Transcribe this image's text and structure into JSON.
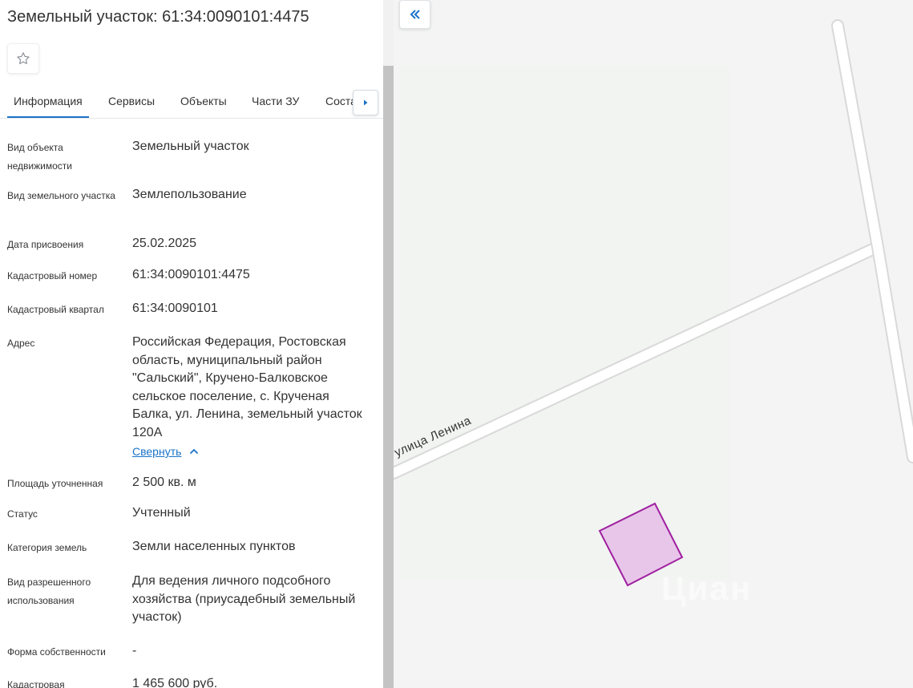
{
  "title": "Земельный участок: 61:34:0090101:4475",
  "favorite_icon": "star-outline-icon",
  "tabs": [
    {
      "label": "Информация",
      "active": true
    },
    {
      "label": "Сервисы",
      "active": false
    },
    {
      "label": "Объекты",
      "active": false
    },
    {
      "label": "Части ЗУ",
      "active": false
    },
    {
      "label": "Соста",
      "active": false
    }
  ],
  "tab_next_icon": "triangle-right-icon",
  "fields": [
    {
      "label": "Вид объекта недвижимости",
      "value": "Земельный участок"
    },
    {
      "label": "Вид земельного участка",
      "value": "Землепользование"
    },
    {
      "label": "Дата присвоения",
      "value": "25.02.2025"
    },
    {
      "label": "Кадастровый номер",
      "value": "61:34:0090101:4475"
    },
    {
      "label": "Кадастровый квартал",
      "value": "61:34:0090101"
    },
    {
      "label": "Адрес",
      "value": "Российская Федерация, Ростовская область, муниципальный район \"Сальский\", Кручено-Балковское сельское поселение, с. Крученая Балка, ул. Ленина, земельный участок 120А"
    },
    {
      "label": "Площадь уточненная",
      "value": "2 500 кв. м"
    },
    {
      "label": "Статус",
      "value": "Учтенный"
    },
    {
      "label": "Категория земель",
      "value": "Земли населенных пунктов"
    },
    {
      "label": "Вид разрешенного использования",
      "value": "Для ведения личного подсобного хозяйства (приусадебный земельный участок)"
    },
    {
      "label": "Форма собственности",
      "value": "-"
    },
    {
      "label": "Кадастровая",
      "value": "1 465 600 руб."
    }
  ],
  "collapse_link": "Свернуть",
  "map": {
    "collapse_icon": "double-chevron-left-icon",
    "street_label": "улица Ленина",
    "watermark": "Циан",
    "parcel_color": "#a020a0",
    "parcel_fill": "#e8c6ea"
  },
  "colors": {
    "accent": "#1a73c9",
    "map_bg": "#f3f4f3"
  }
}
